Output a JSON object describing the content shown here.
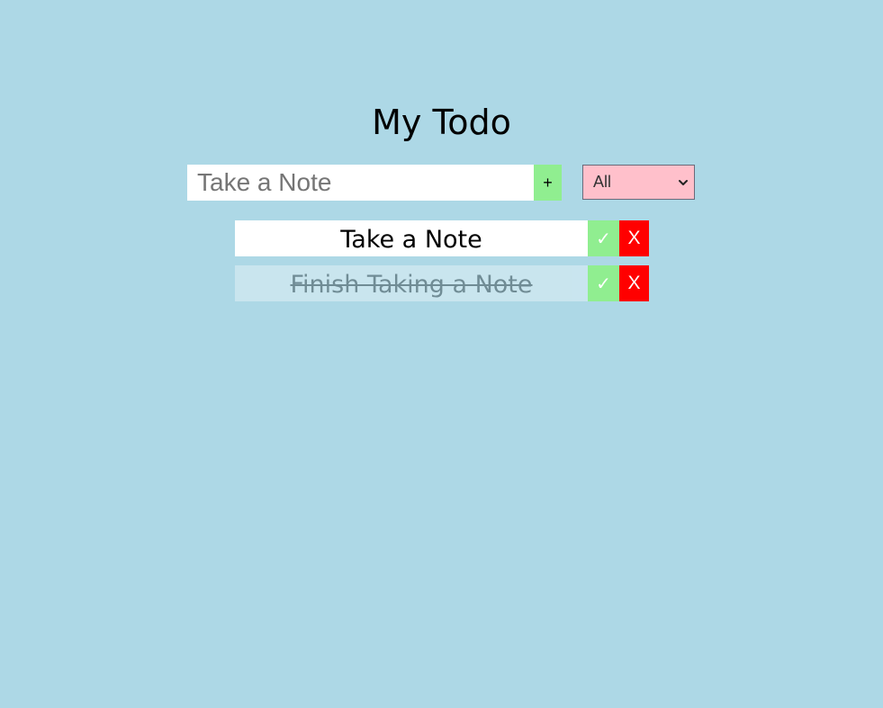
{
  "header": {
    "title": "My Todo"
  },
  "form": {
    "input_placeholder": "Take a Note",
    "input_value": "",
    "add_label": "+",
    "filter": {
      "selected": "All"
    }
  },
  "todos": [
    {
      "text": "Take a Note",
      "completed": false,
      "complete_label": "✓",
      "delete_label": "X"
    },
    {
      "text": "Finish Taking a Note",
      "completed": true,
      "complete_label": "✓",
      "delete_label": "X"
    }
  ],
  "colors": {
    "background": "#add8e6",
    "add_button": "#90ee90",
    "filter_background": "#ffc0cb",
    "complete_button": "#90ee90",
    "delete_button": "#ff0000"
  }
}
